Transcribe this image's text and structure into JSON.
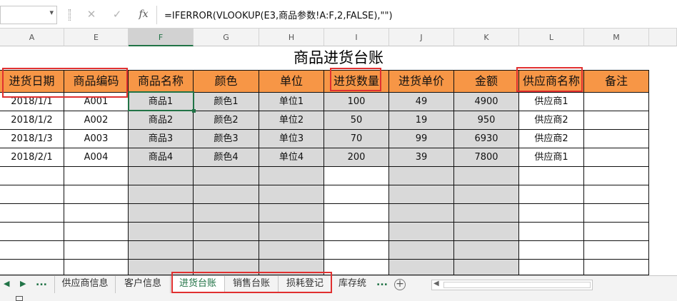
{
  "formula_bar": {
    "name_box": "",
    "formula": "=IFERROR(VLOOKUP(E3,商品参数!A:F,2,FALSE),\"\")",
    "cancel_icon": "close-icon",
    "enter_icon": "check-icon",
    "fx_label": "fx"
  },
  "columns": [
    "A",
    "E",
    "F",
    "G",
    "H",
    "I",
    "J",
    "K",
    "L",
    "M"
  ],
  "sheet": {
    "title": "商品进货台账",
    "headers": [
      "进货日期",
      "商品编码",
      "商品名称",
      "颜色",
      "单位",
      "进货数量",
      "进货单价",
      "金额",
      "供应商名称",
      "备注"
    ],
    "rows": [
      [
        "2018/1/1",
        "A001",
        "商品1",
        "颜色1",
        "单位1",
        "100",
        "49",
        "4900",
        "供应商1",
        ""
      ],
      [
        "2018/1/2",
        "A002",
        "商品2",
        "颜色2",
        "单位2",
        "50",
        "19",
        "950",
        "供应商2",
        ""
      ],
      [
        "2018/1/3",
        "A003",
        "商品3",
        "颜色3",
        "单位3",
        "70",
        "99",
        "6930",
        "供应商2",
        ""
      ],
      [
        "2018/2/1",
        "A004",
        "商品4",
        "颜色4",
        "单位4",
        "200",
        "39",
        "7800",
        "供应商1",
        ""
      ]
    ]
  },
  "tabs": {
    "more_left": "...",
    "items": [
      "供应商信息",
      "客户信息",
      "进货台账",
      "销售台账",
      "损耗登记",
      "库存统"
    ],
    "more_right": "...",
    "active": "进货台账"
  },
  "colors": {
    "header_fill": "#f79646",
    "gray_fill": "#d9d9d9",
    "highlight_border": "#e03030",
    "accent": "#217346"
  }
}
